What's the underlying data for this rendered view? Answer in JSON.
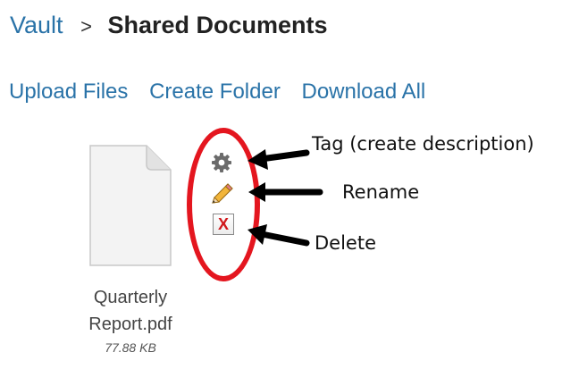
{
  "breadcrumb": {
    "root": "Vault",
    "separator": ">",
    "current": "Shared Documents"
  },
  "actions": {
    "upload": "Upload Files",
    "create_folder": "Create Folder",
    "download_all": "Download All"
  },
  "file": {
    "name_line1": "Quarterly",
    "name_line2": "Report.pdf",
    "size": "77.88 KB"
  },
  "row_actions": {
    "tag_icon": "gear-icon",
    "rename_icon": "pencil-icon",
    "delete_icon": "delete-x-icon",
    "delete_glyph": "X"
  },
  "callouts": {
    "tag": "Tag (create description)",
    "rename": "Rename",
    "delete": "Delete"
  },
  "colors": {
    "link": "#2a73a8",
    "highlight": "#e4161f",
    "delete_x": "#d0181c"
  }
}
